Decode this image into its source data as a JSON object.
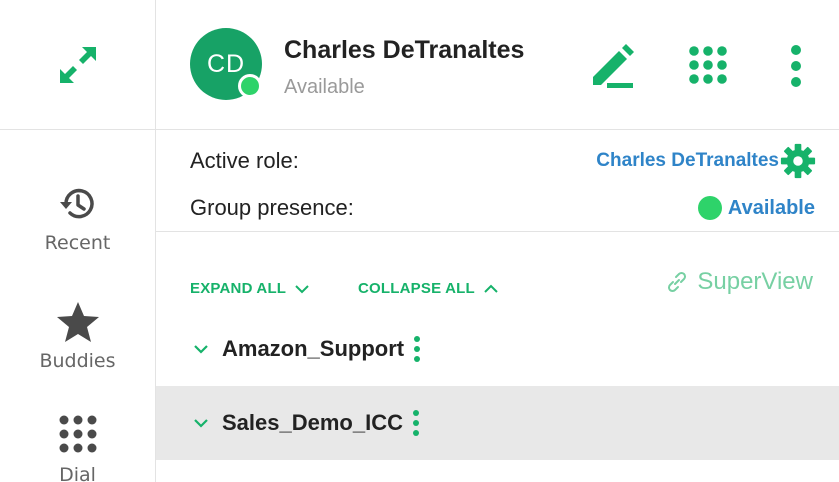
{
  "rail": {
    "expand_icon": "expand-arrows-icon",
    "items": [
      {
        "label": "Recent",
        "icon": "history-icon"
      },
      {
        "label": "Buddies",
        "icon": "star-icon"
      },
      {
        "label": "Dial",
        "icon": "dialpad-icon"
      }
    ]
  },
  "header": {
    "avatar_initials": "CD",
    "user_name": "Charles DeTranaltes",
    "user_status": "Available",
    "buttons": [
      "edit-icon",
      "apps-grid-icon",
      "more-vertical-icon"
    ]
  },
  "role": {
    "active_role_label": "Active role:",
    "active_role_value": "Charles DeTranaltes",
    "group_presence_label": "Group presence:",
    "group_presence_value": "Available"
  },
  "actions": {
    "expand_all": "EXPAND ALL",
    "collapse_all": "COLLAPSE ALL",
    "superview": "SuperView"
  },
  "queues": [
    {
      "name": "Amazon_Support"
    },
    {
      "name": "Sales_Demo_ICC"
    }
  ],
  "colors": {
    "brand_green": "#16b26a",
    "avatar_green": "#17a266",
    "presence_green": "#2ed36a",
    "link_blue": "#2f84c8",
    "selected_row": "#e8e8e8"
  }
}
